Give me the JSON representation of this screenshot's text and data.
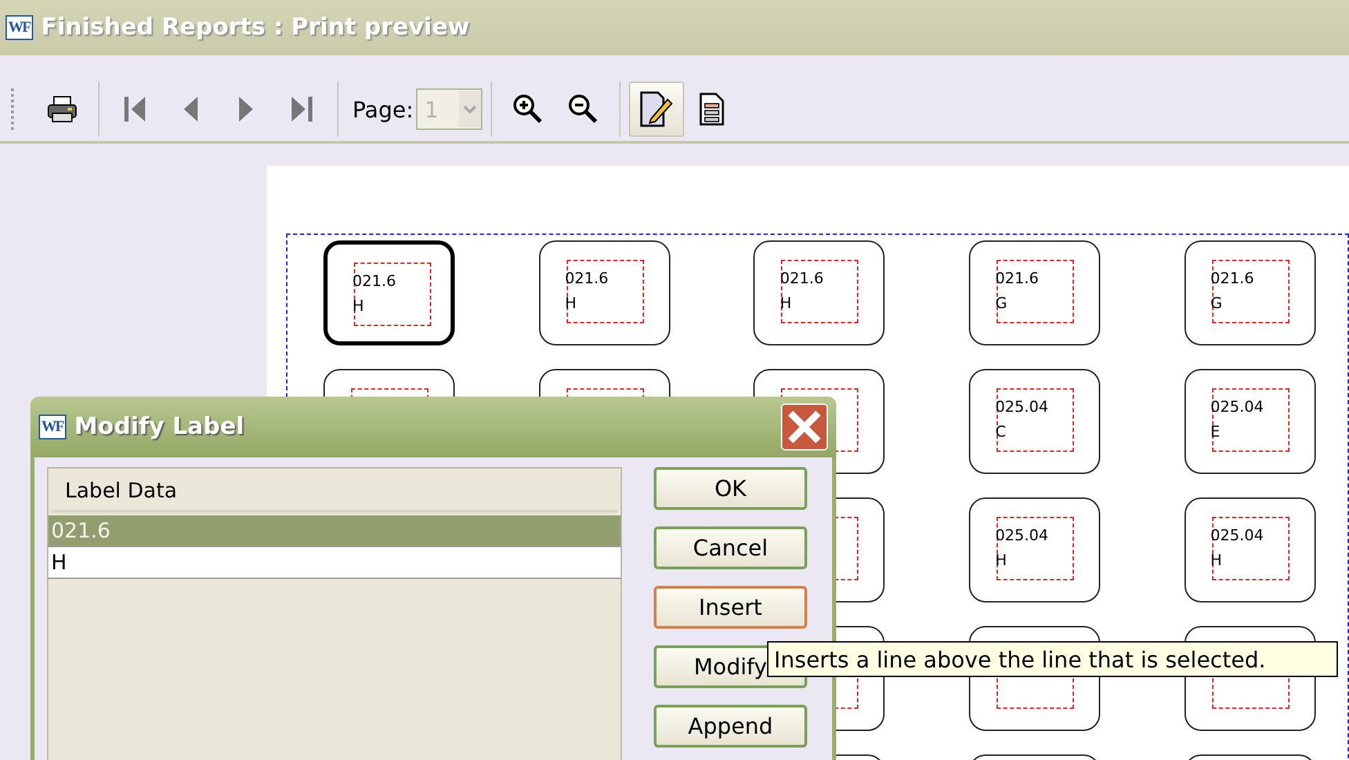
{
  "window": {
    "logo": "WF",
    "title": "Finished Reports : Print preview"
  },
  "toolbar": {
    "items": [
      {
        "kind": "print",
        "pressed": false
      },
      {
        "kind": "first",
        "pressed": false
      },
      {
        "kind": "previous",
        "pressed": false
      },
      {
        "kind": "next",
        "pressed": false
      },
      {
        "kind": "last",
        "pressed": false
      },
      {
        "kind": "page",
        "label": "Page:",
        "value": "1",
        "disabled": true
      },
      {
        "kind": "zoom-in",
        "pressed": false
      },
      {
        "kind": "zoom-out",
        "pressed": false
      },
      {
        "kind": "edit",
        "pressed": true
      },
      {
        "kind": "document",
        "pressed": false
      }
    ]
  },
  "labels": [
    {
      "cells": [
        {
          "lines": [
            "021.6",
            "H"
          ],
          "selected": true
        },
        {
          "lines": [
            "021.6",
            "H"
          ],
          "selected": false
        },
        {
          "lines": [
            "021.6",
            "H"
          ],
          "selected": false
        },
        {
          "lines": [
            "021.6",
            "G"
          ],
          "selected": false
        },
        {
          "lines": [
            "021.6",
            "G"
          ],
          "selected": false
        }
      ]
    },
    {
      "cells": [
        {
          "selected": false
        },
        {
          "selected": false
        },
        {
          "selected": false
        },
        {
          "lines": [
            "025.04",
            "C"
          ],
          "selected": false
        },
        {
          "lines": [
            "025.04",
            "E"
          ],
          "selected": false
        }
      ]
    },
    {
      "cells": [
        {
          "selected": false
        },
        {
          "lines": [
            "025.04",
            "H"
          ],
          "selected": false
        },
        {
          "lines": [
            "025.04",
            "H"
          ],
          "selected": false
        }
      ]
    },
    {
      "cells": [
        {
          "selected": false
        },
        {
          "selected": false
        },
        {
          "selected": false
        }
      ]
    },
    {
      "cells": [
        {
          "selected": false
        },
        {
          "selected": false
        },
        {
          "selected": false
        }
      ]
    }
  ],
  "dialog": {
    "logo": "WF",
    "title": "Modify Label",
    "list": {
      "column": "Label Data",
      "rows": [
        {
          "text": "021.6",
          "selected": true
        },
        {
          "text": "H",
          "selected": false
        }
      ]
    },
    "buttons": [
      {
        "label": "OK",
        "focused": false
      },
      {
        "label": "Cancel",
        "focused": false
      },
      {
        "label": "Insert",
        "focused": true
      },
      {
        "label": "Modify",
        "focused": false
      },
      {
        "label": "Append",
        "focused": false
      }
    ]
  },
  "tooltip": "Inserts a line above the line that is selected."
}
